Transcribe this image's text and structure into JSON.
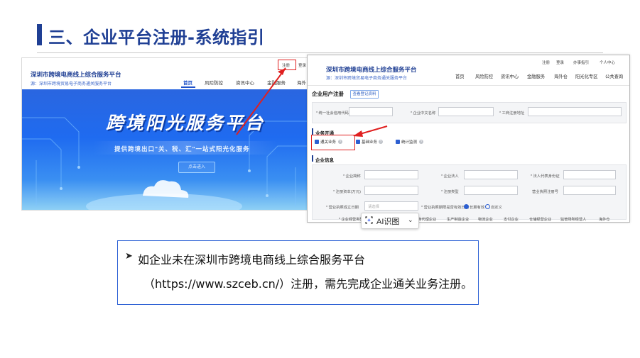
{
  "slide": {
    "title": "三、企业平台注册-系统指引",
    "note": {
      "bullet": "➤",
      "line1": "如企业未在深圳市跨境电商线上综合服务平台",
      "line2": "（https://www.szceb.cn/）注册，需先完成企业通关业务注册。"
    }
  },
  "shot1": {
    "logo_title": "深圳市跨境电商线上综合服务平台",
    "logo_sub": "源：深圳市跨境贸易电子商务通关服务平台",
    "top_links": [
      "注册",
      "登录"
    ],
    "nav": [
      "首页",
      "风险防控",
      "资讯中心",
      "金融服务",
      "海外"
    ],
    "banner_title": "跨境阳光服务平台",
    "banner_sub": "提供跨境出口\"关、税、汇\"一站式阳光化服务",
    "enter_button": "点击进入"
  },
  "shot2": {
    "logo_title": "深圳市跨境电商线上综合服务平台",
    "logo_sub": "源：深圳市跨境贸易电子商务通关服务平台",
    "top_links": [
      "注册",
      "登录",
      "办事指引",
      "个人中心"
    ],
    "nav": [
      "首页",
      "风险防控",
      "资讯中心",
      "金融服务",
      "海外仓",
      "阳光化专区",
      "公共查询"
    ],
    "section_register": "企业用户注册",
    "view_button": "查看登记资料",
    "basic_labels": [
      "* 统一社会信用代码",
      "* 企业中文名称",
      "* 工商注册地址"
    ],
    "section_business": "业务开通",
    "business_checks": [
      "通关业务",
      "基础业务",
      "统计监测"
    ],
    "section_info": "企业信息",
    "info_row1": [
      "* 企业简称",
      "* 企业法人",
      "* 法人代表身份证"
    ],
    "info_row2": [
      "* 注册资本(万元)",
      "* 注册类型",
      "营业执照注册号"
    ],
    "info_row3_label1": "* 营业执照成立日期",
    "date_placeholder": "请选择",
    "info_row3_label2": "* 营业执照期限是否有效日期",
    "radio_long": "长期有效",
    "radio_custom": "自定义",
    "foot_labels": [
      "* 企业经营类型",
      "电商代理企业",
      "生产制造企业",
      "物流企业",
      "支付企业",
      "仓储经营企业",
      "监管场所经营人",
      "海外仓"
    ]
  },
  "ai_button": {
    "label": "AI识图",
    "icon": "scan-icon",
    "chevron": "⌄"
  },
  "colors": {
    "brand_blue": "#1f3f94",
    "highlight_red": "#e02020",
    "note_border": "#2b5fd4"
  }
}
